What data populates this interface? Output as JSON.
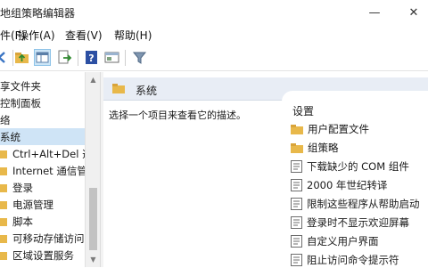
{
  "window": {
    "title": "地组策略编辑器",
    "minimize_glyph": "—",
    "close_glyph": "✕"
  },
  "menu": [
    "件(F)",
    "操作(A)",
    "查看(V)",
    "帮助(H)"
  ],
  "toolbar": {
    "icons": [
      "back-arrow-icon",
      "forward-arrow-icon",
      "up-folder-icon",
      "show-hide-tree-icon",
      "export-list-icon",
      "help-icon",
      "properties-panel-icon",
      "filter-icon"
    ]
  },
  "tree": {
    "items": [
      {
        "label": "享文件夹",
        "selected": false
      },
      {
        "label": "控制面板",
        "selected": false
      },
      {
        "label": "络",
        "selected": false
      },
      {
        "label": "系统",
        "selected": true
      },
      {
        "label": "Ctrl+Alt+Del 选",
        "selected": false
      },
      {
        "label": "Internet 通信管",
        "selected": false
      },
      {
        "label": "登录",
        "selected": false
      },
      {
        "label": "电源管理",
        "selected": false
      },
      {
        "label": "脚本",
        "selected": false
      },
      {
        "label": "可移动存储访问",
        "selected": false
      },
      {
        "label": "区域设置服务",
        "selected": false
      }
    ]
  },
  "details": {
    "header": "系统",
    "description": "选择一个项目来查看它的描述。"
  },
  "settings": {
    "column_header": "设置",
    "rows": [
      {
        "label": "用户配置文件",
        "type": "folder"
      },
      {
        "label": "组策略",
        "type": "folder"
      },
      {
        "label": "下载缺少的 COM 组件",
        "type": "policy"
      },
      {
        "label": "2000 年世纪转译",
        "type": "policy"
      },
      {
        "label": "限制这些程序从帮助启动",
        "type": "policy"
      },
      {
        "label": "登录时不显示欢迎屏幕",
        "type": "policy"
      },
      {
        "label": "自定义用户界面",
        "type": "policy"
      },
      {
        "label": "阻止访问命令提示符",
        "type": "policy"
      }
    ]
  },
  "colors": {
    "accent_selection": "#cfe4f6",
    "header_band": "#e8edf5",
    "folder": "#e8b84a"
  }
}
